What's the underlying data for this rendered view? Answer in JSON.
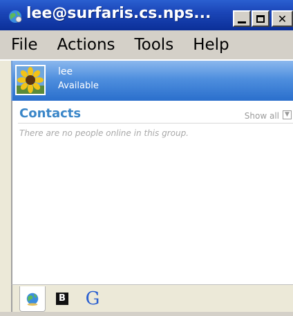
{
  "window": {
    "title": "lee@surfaris.cs.nps...",
    "minimize_icon": "minimize-icon",
    "maximize_icon": "maximize-icon",
    "close_label": "✕"
  },
  "menu": {
    "items": [
      "File",
      "Actions",
      "Tools",
      "Help"
    ]
  },
  "user": {
    "name": "lee",
    "status": "Available"
  },
  "contacts": {
    "title": "Contacts",
    "show_all": "Show all",
    "empty_message": "There are no people online in this group."
  },
  "tabs": {
    "b_label": "B",
    "g_label": "G"
  },
  "colors": {
    "title_bar": "#1b46b8",
    "contacts_title": "#3a86c8",
    "header_gradient_top": "#8bb8ee",
    "header_gradient_bottom": "#2a6fcc"
  }
}
